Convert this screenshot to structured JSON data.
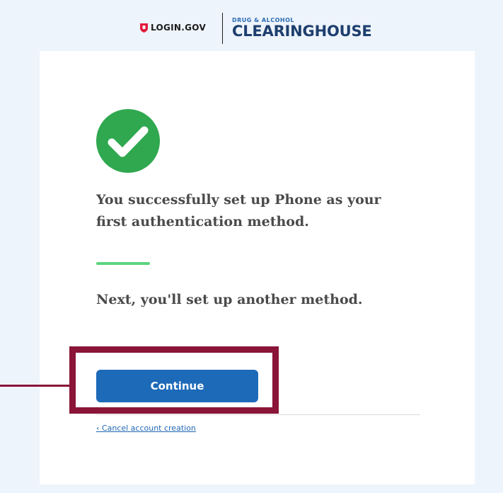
{
  "header": {
    "login_logo_text": "LOGIN.GOV",
    "partner_small_text": "DRUG & ALCOHOL",
    "partner_big_text": "CLEARINGHOUSE"
  },
  "main": {
    "success_icon": "check-circle-icon",
    "headline": "You successfully set up Phone as your first authentication method.",
    "next_text": "Next, you'll set up another method.",
    "continue_label": "Continue",
    "cancel_link": "‹ Cancel account creation"
  },
  "colors": {
    "page_background": "#eef4fb",
    "card_background": "#ffffff",
    "primary_button": "#1d6ab9",
    "success_green": "#2fa84f",
    "accent_rule": "#5ed47e",
    "heading_text": "#4a4a4a",
    "link": "#2168b5",
    "callout": "#8a1538",
    "login_shield": "#e21c3d",
    "clearinghouse_blue": "#1e3f6e"
  }
}
